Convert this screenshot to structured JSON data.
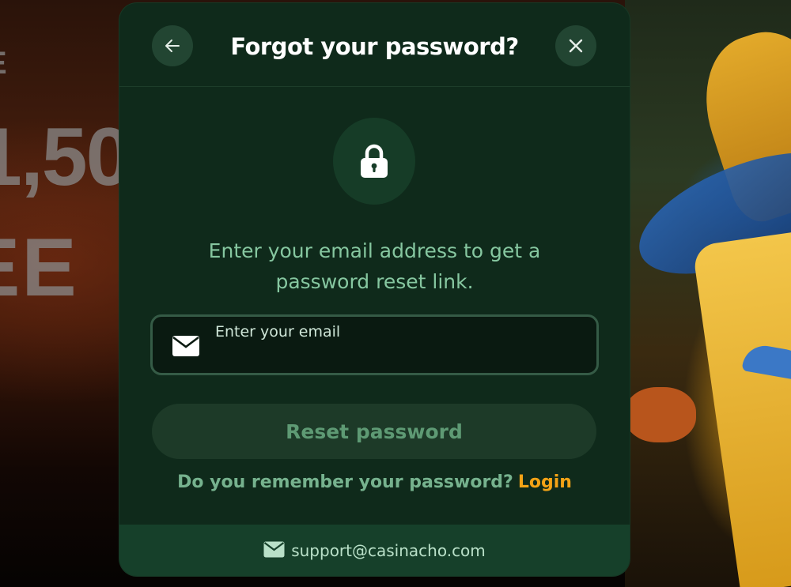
{
  "background": {
    "promo_lines": [
      "E",
      "1,50",
      "EE"
    ]
  },
  "modal": {
    "title": "Forgot your password?",
    "back_icon": "arrow-left-icon",
    "close_icon": "close-icon",
    "lock_icon": "lock-icon",
    "instruction": "Enter your email address to get a password reset link.",
    "email_field": {
      "label": "Enter your email",
      "value": "",
      "icon": "mail-icon"
    },
    "reset_button": "Reset password",
    "remember_text": "Do you remember your password?",
    "login_link": "Login",
    "footer": {
      "icon": "mail-icon",
      "support_email": "support@casinacho.com"
    }
  },
  "colors": {
    "modal_bg": "#0f2a1b",
    "accent_login": "#f4a316",
    "text_green": "#86c7a0"
  }
}
